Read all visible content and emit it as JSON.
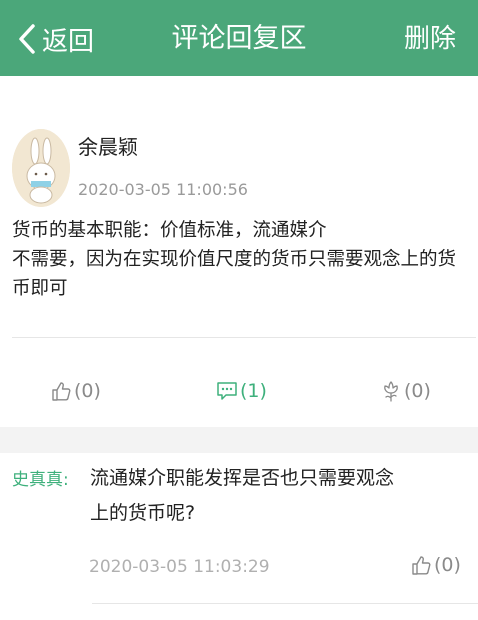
{
  "header": {
    "back_label": "返回",
    "title": "评论回复区",
    "delete_label": "删除",
    "bg_color": "#4ba77a"
  },
  "post": {
    "author": "余晨颖",
    "time": "2020-03-05 11:00:56",
    "content": "货币的基本职能：价值标准，流通媒介\n不需要，因为在实现价值尺度的货币只需要观念上的货币即可",
    "avatar_icon": "bunny-avatar"
  },
  "actions": {
    "like": {
      "icon": "thumbs-up-icon",
      "count": "(0)"
    },
    "comment": {
      "icon": "comment-icon",
      "count": "(1)",
      "color": "#3eb07c"
    },
    "flower": {
      "icon": "flower-icon",
      "count": "(0)"
    }
  },
  "replies": [
    {
      "author": "史真真:",
      "text": "流通媒介职能发挥是否也只需要观念上的货币呢?",
      "time": "2020-03-05 11:03:29",
      "like_count": "(0)"
    }
  ]
}
